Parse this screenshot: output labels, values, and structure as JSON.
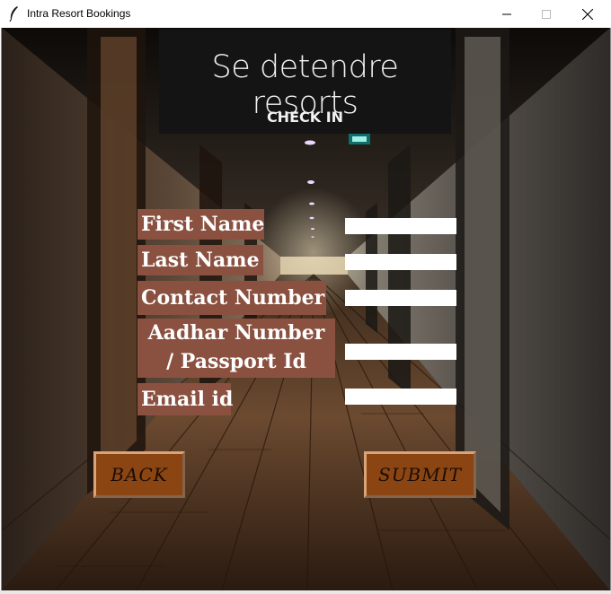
{
  "window": {
    "title": "Intra Resort Bookings",
    "icons": {
      "app": "feather-icon",
      "minimize": "minimize-icon",
      "maximize": "maximize-icon",
      "close": "close-icon"
    }
  },
  "header": {
    "brand": "Se detendre resorts",
    "subtitle": "CHECK IN"
  },
  "form": {
    "fields": [
      {
        "label": "First Name",
        "value": ""
      },
      {
        "label": "Last Name",
        "value": ""
      },
      {
        "label": "Contact Number",
        "value": ""
      },
      {
        "label": "Aadhar Number / Passport Id",
        "value": ""
      },
      {
        "label": "Email id",
        "value": ""
      }
    ]
  },
  "buttons": {
    "back": "BACK",
    "submit": "SUBMIT"
  },
  "colors": {
    "label_bg": "#8a5140",
    "button_bg": "#8b4513",
    "banner_bg": "#141414"
  }
}
